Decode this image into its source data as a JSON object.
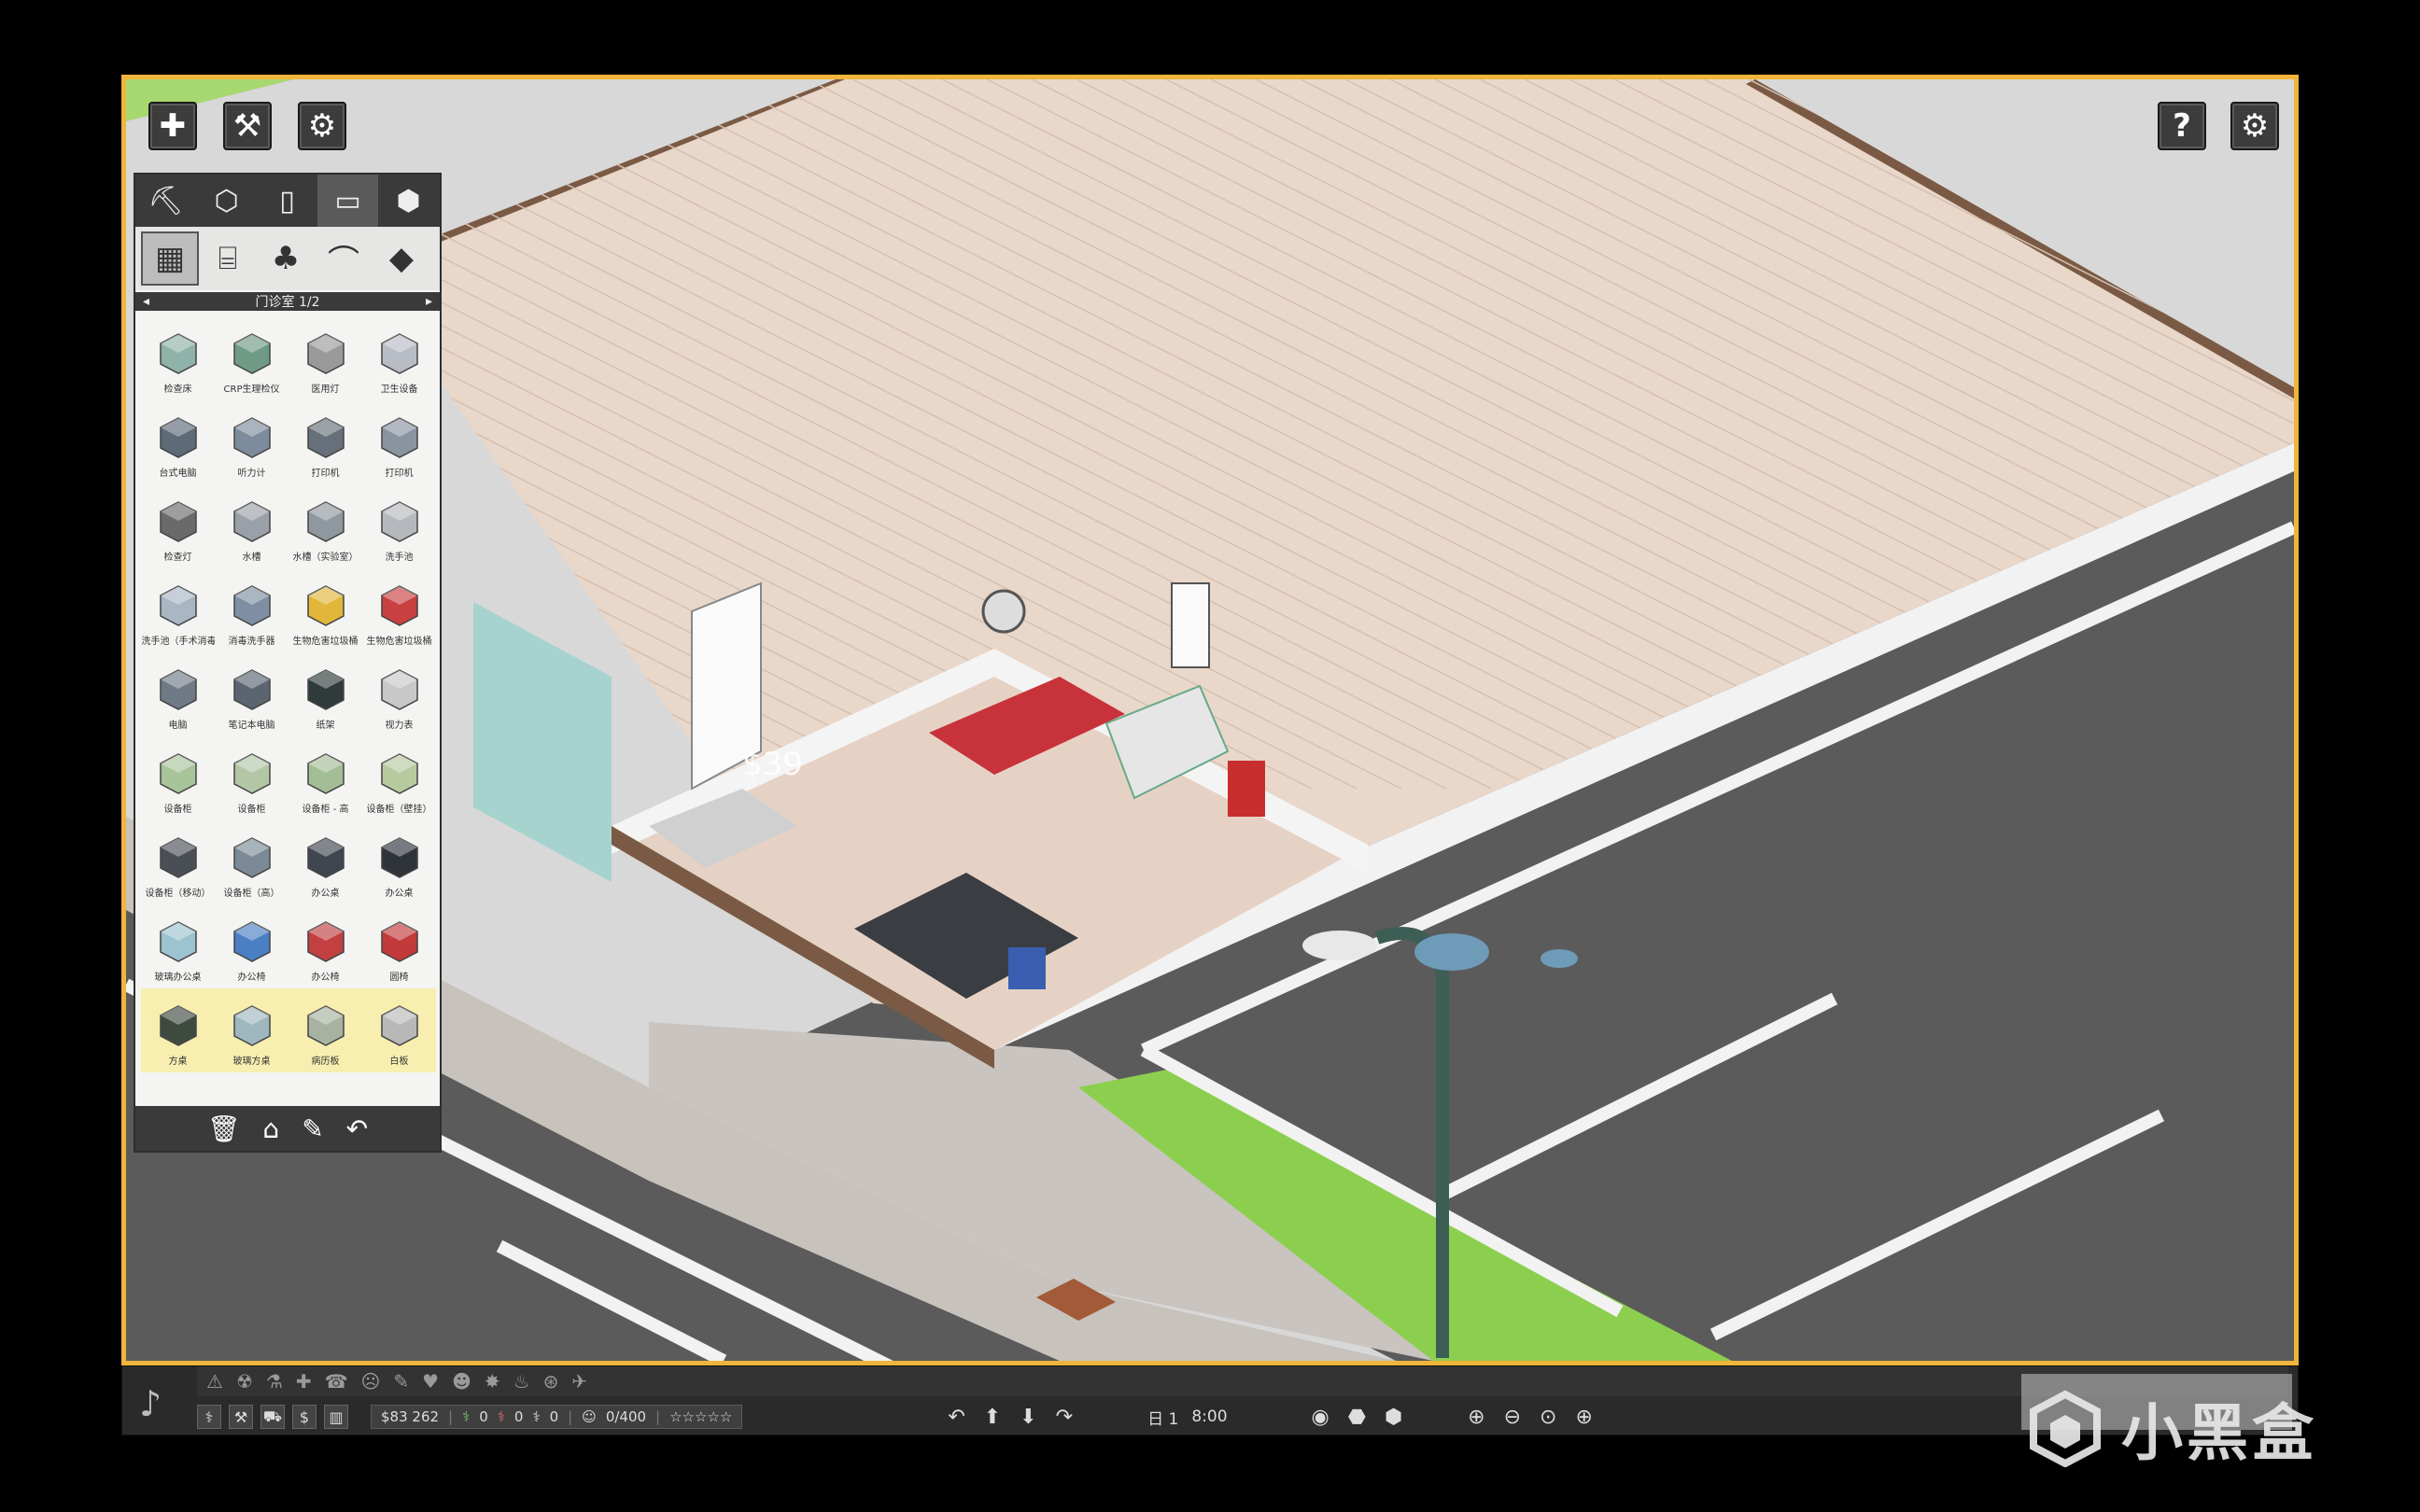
{
  "hud": {
    "top_left": [
      {
        "icon": "plus-icon",
        "glyph": "✚"
      },
      {
        "icon": "hammer-icon",
        "glyph": "⚒"
      },
      {
        "icon": "gears-icon",
        "glyph": "⚙"
      }
    ],
    "top_right": [
      {
        "icon": "help-icon",
        "glyph": "?"
      },
      {
        "icon": "settings-icon",
        "glyph": "⚙"
      }
    ]
  },
  "build_panel": {
    "category_tabs": [
      {
        "icon": "crane-icon",
        "glyph": "⛏"
      },
      {
        "icon": "floor-cube-icon",
        "glyph": "⬡"
      },
      {
        "icon": "door-window-icon",
        "glyph": "▯"
      },
      {
        "icon": "monitor-icon",
        "glyph": "▭"
      },
      {
        "icon": "boxes-icon",
        "glyph": "⬢"
      }
    ],
    "sub_tabs": [
      {
        "icon": "medical-equipment-icon",
        "glyph": "▦"
      },
      {
        "icon": "desk-icon",
        "glyph": "⌸"
      },
      {
        "icon": "plant-icon",
        "glyph": "♣"
      },
      {
        "icon": "lamp-icon",
        "glyph": "⌒"
      },
      {
        "icon": "paint-bucket-icon",
        "glyph": "◆"
      }
    ],
    "page_title": "门诊室 1/2",
    "page_prev": "◂",
    "page_next": "▸",
    "items": [
      {
        "name": "检查床",
        "hl": false,
        "color": "#8fb3a8"
      },
      {
        "name": "CRP生理检仪",
        "hl": false,
        "color": "#6f9a86"
      },
      {
        "name": "医用灯",
        "hl": false,
        "color": "#9a9a9a"
      },
      {
        "name": "卫生设备",
        "hl": false,
        "color": "#b8bcc4"
      },
      {
        "name": "台式电脑",
        "hl": false,
        "color": "#5d6a78"
      },
      {
        "name": "听力计",
        "hl": false,
        "color": "#7d8c9c"
      },
      {
        "name": "打印机",
        "hl": false,
        "color": "#66707a"
      },
      {
        "name": "打印机",
        "hl": false,
        "color": "#8a93a0"
      },
      {
        "name": "检查灯",
        "hl": false,
        "color": "#6a6a6a"
      },
      {
        "name": "水槽",
        "hl": false,
        "color": "#9aa0a8"
      },
      {
        "name": "水槽（实验室）",
        "hl": false,
        "color": "#8f979f"
      },
      {
        "name": "洗手池",
        "hl": false,
        "color": "#b5b9be"
      },
      {
        "name": "洗手池（手术消毒室）",
        "hl": false,
        "color": "#a9b6c3"
      },
      {
        "name": "消毒洗手器",
        "hl": false,
        "color": "#7f8fa3"
      },
      {
        "name": "生物危害垃圾桶",
        "hl": false,
        "color": "#e2b63a"
      },
      {
        "name": "生物危害垃圾桶",
        "hl": false,
        "color": "#c94040"
      },
      {
        "name": "电脑",
        "hl": false,
        "color": "#707a86"
      },
      {
        "name": "笔记本电脑",
        "hl": false,
        "color": "#5b6570"
      },
      {
        "name": "纸架",
        "hl": false,
        "color": "#2f3a3a"
      },
      {
        "name": "视力表",
        "hl": false,
        "color": "#c8c8c8"
      },
      {
        "name": "设备柜",
        "hl": false,
        "color": "#a8c49a"
      },
      {
        "name": "设备柜",
        "hl": false,
        "color": "#b3c7a6"
      },
      {
        "name": "设备柜 - 高",
        "hl": false,
        "color": "#a3bd96"
      },
      {
        "name": "设备柜（壁挂）",
        "hl": false,
        "color": "#b7ca9f"
      },
      {
        "name": "设备柜（移动）",
        "hl": false,
        "color": "#4a4f55"
      },
      {
        "name": "设备柜（高）",
        "hl": false,
        "color": "#7b8a96"
      },
      {
        "name": "办公桌",
        "hl": false,
        "color": "#3f4650"
      },
      {
        "name": "办公桌",
        "hl": false,
        "color": "#2f343a"
      },
      {
        "name": "玻璃办公桌",
        "hl": false,
        "color": "#9cc3cf"
      },
      {
        "name": "办公椅",
        "hl": false,
        "color": "#4a7fc4"
      },
      {
        "name": "办公椅",
        "hl": false,
        "color": "#c24040"
      },
      {
        "name": "圆椅",
        "hl": false,
        "color": "#c23a3a"
      },
      {
        "name": "方桌",
        "hl": true,
        "color": "#3f4a3f"
      },
      {
        "name": "玻璃方桌",
        "hl": true,
        "color": "#9fb7bf"
      },
      {
        "name": "病历板",
        "hl": true,
        "color": "#a7b3a0"
      },
      {
        "name": "白板",
        "hl": true,
        "color": "#b8b8b8"
      }
    ],
    "actions": [
      {
        "icon": "trash-icon",
        "glyph": "🗑"
      },
      {
        "icon": "factory-icon",
        "glyph": "⌂"
      },
      {
        "icon": "eyedropper-icon",
        "glyph": "✎"
      },
      {
        "icon": "undo-icon",
        "glyph": "↶"
      }
    ]
  },
  "world": {
    "price_label": "$39"
  },
  "status_bar": {
    "money": "$83 262",
    "staff_1": "0",
    "staff_2": "0",
    "staff_3": "0",
    "capacity": "0/400",
    "rating": "☆☆☆☆☆",
    "day_label": "日 1",
    "time": "8:00",
    "left_icons": [
      {
        "icon": "staff-icon",
        "glyph": "⚕"
      },
      {
        "icon": "tools-icon",
        "glyph": "⚒"
      },
      {
        "icon": "ambulance-icon",
        "glyph": "⛟"
      },
      {
        "icon": "money-icon",
        "glyph": "$"
      },
      {
        "icon": "stats-icon",
        "glyph": "▥"
      }
    ],
    "speed_controls": [
      {
        "icon": "rotate-left-icon",
        "glyph": "↶"
      },
      {
        "icon": "floor-up-icon",
        "glyph": "⬆"
      },
      {
        "icon": "floor-down-icon",
        "glyph": "⬇"
      },
      {
        "icon": "rotate-right-icon",
        "glyph": "↷"
      }
    ],
    "view_controls": [
      {
        "icon": "eye-icon",
        "glyph": "◉"
      },
      {
        "icon": "walls-low-icon",
        "glyph": "⬣"
      },
      {
        "icon": "walls-high-icon",
        "glyph": "⬢"
      }
    ],
    "zoom_controls": [
      {
        "icon": "zoom-in-icon",
        "glyph": "⊕"
      },
      {
        "icon": "zoom-out-icon",
        "glyph": "⊖"
      },
      {
        "icon": "zoom-reset-icon",
        "glyph": "⊙"
      },
      {
        "icon": "zoom-fit-icon",
        "glyph": "⊕"
      }
    ],
    "notif_icons": [
      "⚠",
      "☢",
      "⚗",
      "✚",
      "☎",
      "☹",
      "✎",
      "♥",
      "☻",
      "✸",
      "♨",
      "⊛",
      "✈"
    ]
  },
  "watermark": {
    "text": "小黑盒"
  },
  "colors": {
    "frame": "#f0b53a",
    "floor": "#e8d4c6",
    "asphalt": "#5b5b5b",
    "wall": "#8a6a52"
  }
}
